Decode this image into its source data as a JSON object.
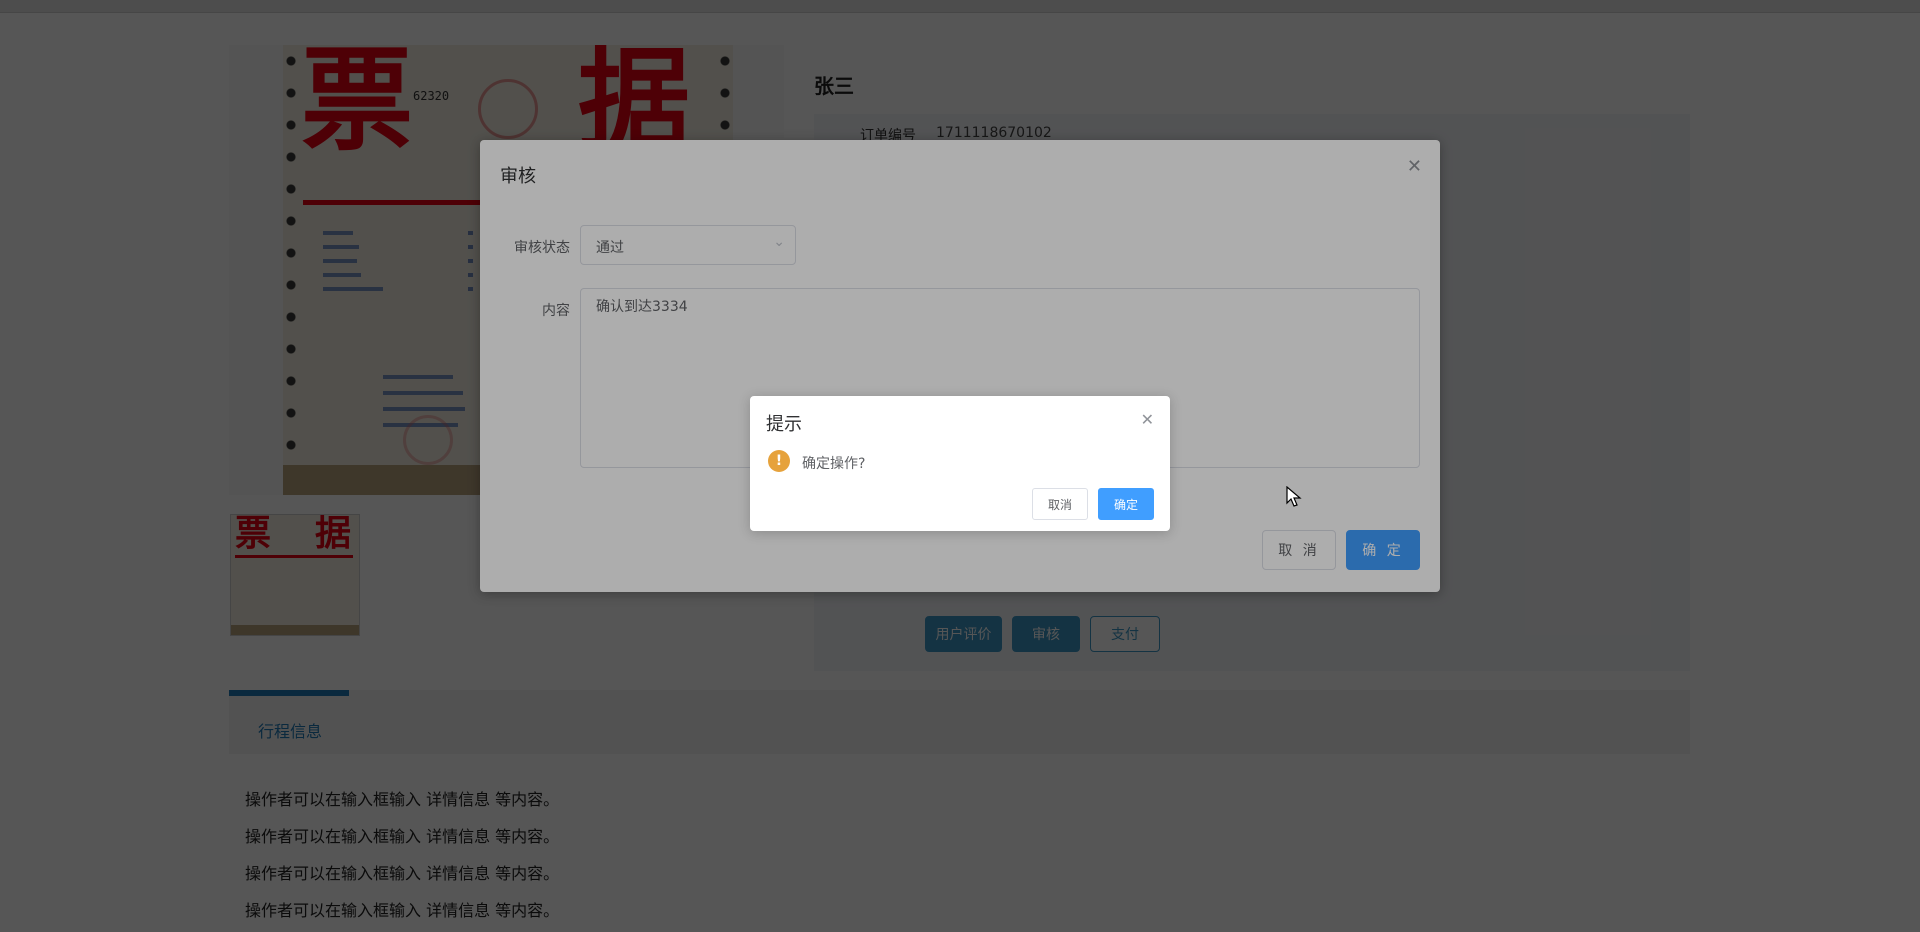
{
  "page": {
    "user_name": "张三",
    "order_label": "订单编号",
    "order_value": "1711118670102",
    "actions": {
      "review_label": "用户评价",
      "audit_label": "审核",
      "pay_label": "支付"
    },
    "tabs": [
      {
        "label": "行程信息",
        "active": true
      }
    ],
    "detail_lines": [
      "操作者可以在输入框输入  详情信息  等内容。",
      "操作者可以在输入框输入  详情信息  等内容。",
      "操作者可以在输入框输入  详情信息  等内容。",
      "操作者可以在输入框输入  详情信息  等内容。"
    ],
    "receipt_image": {
      "chars": [
        "票",
        "据"
      ],
      "serial": "62320"
    }
  },
  "audit_dialog": {
    "title": "审核",
    "status_label": "审核状态",
    "status_value": "通过",
    "content_label": "内容",
    "content_value": "确认到达3334",
    "cancel_label": "取 消",
    "ok_label": "确 定"
  },
  "confirm_box": {
    "title": "提示",
    "message": "确定操作?",
    "cancel_label": "取消",
    "ok_label": "确定"
  },
  "colors": {
    "primary": "#409eff",
    "teal_button": "#3c99c9",
    "tab_accent": "#1e7ab8",
    "warning": "#e6a23c",
    "stamp_red": "#e60012"
  },
  "icons": {
    "close": "close-icon",
    "select_arrow": "chevron-down-icon",
    "warning": "warning-icon"
  }
}
